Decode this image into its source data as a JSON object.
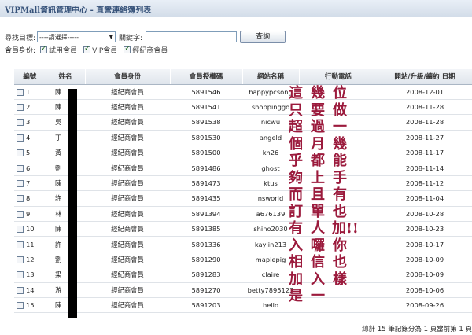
{
  "window": {
    "title": "VIPMall資訊管理中心 - 直營連絡簿列表"
  },
  "search": {
    "target_label": "尋找目標:",
    "target_value": "----請選擇-----",
    "keyword_label": "關鍵字:",
    "keyword_value": "",
    "query_button": "查詢",
    "identity_label": "會員身份:",
    "filters": [
      {
        "label": "試用會員",
        "checked": true
      },
      {
        "label": "VIP會員",
        "checked": true
      },
      {
        "label": "經紀商會員",
        "checked": true
      }
    ]
  },
  "table": {
    "headers": [
      "編號",
      "姓名",
      "會員身份",
      "會員授權碼",
      "網站名稱",
      "行動電話",
      "開站/升級/續約 日期"
    ],
    "rows": [
      {
        "no": "1",
        "name": "陳",
        "type": "經紀商會員",
        "code": "5891546",
        "site": "happypcsong",
        "phone": "",
        "date": "2008-12-01"
      },
      {
        "no": "2",
        "name": "陳",
        "type": "經紀商會員",
        "code": "5891541",
        "site": "shoppinggo",
        "phone": "",
        "date": "2008-11-28"
      },
      {
        "no": "3",
        "name": "吳",
        "type": "經紀商會員",
        "code": "5891538",
        "site": "nicwu",
        "phone": "",
        "date": "2008-11-28"
      },
      {
        "no": "4",
        "name": "丁",
        "type": "經紀商會員",
        "code": "5891530",
        "site": "angeld",
        "phone": "",
        "date": "2008-11-27"
      },
      {
        "no": "5",
        "name": "黃",
        "type": "經紀商會員",
        "code": "5891500",
        "site": "kh26",
        "phone": "",
        "date": "2008-11-17"
      },
      {
        "no": "6",
        "name": "劉",
        "type": "經紀商會員",
        "code": "5891486",
        "site": "ghost",
        "phone": "",
        "date": "2008-11-14"
      },
      {
        "no": "7",
        "name": "陳",
        "type": "經紀商會員",
        "code": "5891473",
        "site": "ktus",
        "phone": "",
        "date": "2008-11-12"
      },
      {
        "no": "8",
        "name": "許",
        "type": "經紀商會員",
        "code": "5891435",
        "site": "nsworld",
        "phone": "",
        "date": "2008-11-04"
      },
      {
        "no": "9",
        "name": "林",
        "type": "經紀商會員",
        "code": "5891394",
        "site": "a676139",
        "phone": "",
        "date": "2008-10-28"
      },
      {
        "no": "10",
        "name": "陳",
        "type": "經紀商會員",
        "code": "5891385",
        "site": "shino2030",
        "phone": "",
        "date": "2008-10-23"
      },
      {
        "no": "11",
        "name": "許",
        "type": "經紀商會員",
        "code": "5891336",
        "site": "kaylin213",
        "phone": "",
        "date": "2008-10-17"
      },
      {
        "no": "12",
        "name": "劉",
        "type": "經紀商會員",
        "code": "5891290",
        "site": "maplepig",
        "phone": "",
        "date": "2008-10-09"
      },
      {
        "no": "13",
        "name": "梁",
        "type": "經紀商會員",
        "code": "5891283",
        "site": "claire",
        "phone": "",
        "date": "2008-10-09"
      },
      {
        "no": "14",
        "name": "游",
        "type": "經紀商會員",
        "code": "5891270",
        "site": "betty7895123",
        "phone": "",
        "date": "2008-10-06"
      },
      {
        "no": "15",
        "name": "陳",
        "type": "經紀商會員",
        "code": "5891203",
        "site": "hello",
        "phone": "",
        "date": "2008-09-26"
      }
    ]
  },
  "overlay": {
    "columns": [
      "這只超個乎夠而訂有入相加是",
      "幾要過月都上且單人囉信入一",
      "位做一幾能手有也加!!你也樣"
    ],
    "color": "#9b1a3c"
  },
  "footer": {
    "text": "總計 15 筆記錄分為 1 頁當前第 1 頁"
  }
}
